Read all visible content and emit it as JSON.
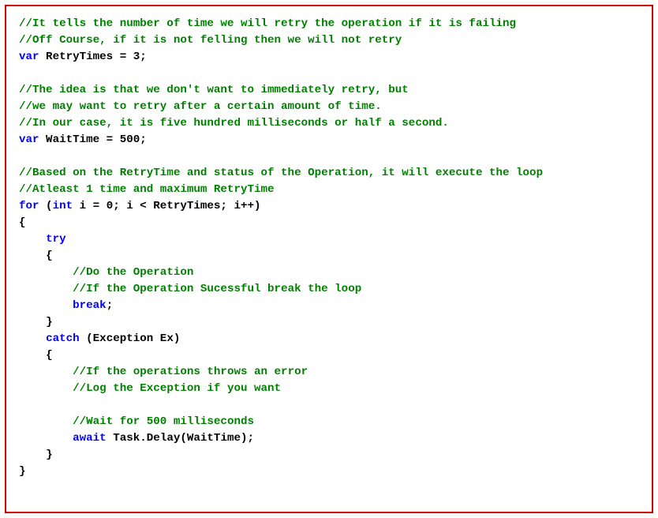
{
  "code": {
    "c1": "//It tells the number of time we will retry the operation if it is failing",
    "c2": "//Off Course, if it is not felling then we will not retry",
    "k_var1": "var",
    "t_retry_decl": " RetryTimes = 3;",
    "c3": "//The idea is that we don't want to immediately retry, but",
    "c4": "//we may want to retry after a certain amount of time.",
    "c5": "//In our case, it is five hundred milliseconds or half a second.",
    "k_var2": "var",
    "t_wait_decl": " WaitTime = 500;",
    "c6": "//Based on the RetryTime and status of the Operation, it will execute the loop",
    "c7": "//Atleast 1 time and maximum RetryTime",
    "k_for": "for",
    "t_for1": " (",
    "k_int": "int",
    "t_for2": " i = 0; i < RetryTimes; i++)",
    "t_brace_open1": "{",
    "t_indent1": "    ",
    "k_try": "try",
    "t_indent2": "    ",
    "t_brace_open2": "{",
    "t_indent3": "        ",
    "c8": "//Do the Operation",
    "t_indent4": "        ",
    "c9": "//If the Operation Sucessful break the loop",
    "t_indent5": "        ",
    "k_break": "break",
    "t_semicolon": ";",
    "t_indent6": "    ",
    "t_brace_close1": "}",
    "t_indent7": "    ",
    "k_catch": "catch",
    "t_catch1": " (Exception Ex)",
    "t_indent8": "    ",
    "t_brace_open3": "{",
    "t_indent9": "        ",
    "c10": "//If the operations throws an error",
    "t_indent10": "        ",
    "c11": "//Log the Exception if you want",
    "t_indent11": "        ",
    "c12": "//Wait for 500 milliseconds",
    "t_indent12": "        ",
    "k_await": "await",
    "t_task": " Task.Delay(WaitTime);",
    "t_indent13": "    ",
    "t_brace_close2": "}",
    "t_brace_close3": "}"
  }
}
